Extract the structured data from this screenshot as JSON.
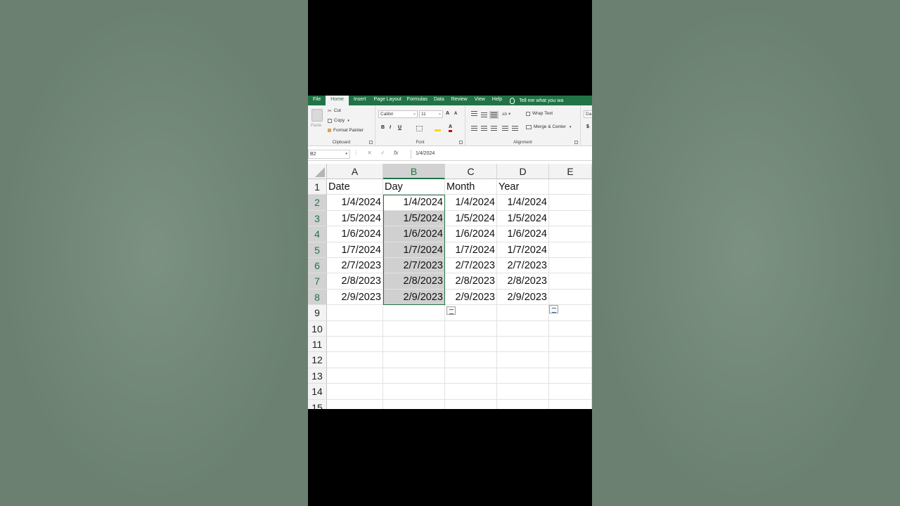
{
  "ribbon": {
    "tabs": [
      "File",
      "Home",
      "Insert",
      "Page Layout",
      "Formulas",
      "Data",
      "Review",
      "View",
      "Help"
    ],
    "active_tab": "Home",
    "tell_me": "Tell me what you wa",
    "clipboard": {
      "paste": "Paste",
      "cut": "Cut",
      "copy": "Copy",
      "format_painter": "Format Painter",
      "label": "Clipboard"
    },
    "font": {
      "name": "Calibri",
      "size": "11",
      "bold": "B",
      "italic": "I",
      "underline": "U",
      "grow": "A",
      "shrink": "A",
      "color_glyph": "A",
      "label": "Font"
    },
    "alignment": {
      "wrap_text": "Wrap Text",
      "merge_center": "Merge & Center",
      "label": "Alignment"
    },
    "number": {
      "format_fragment": "Da",
      "currency": "$"
    }
  },
  "formula_bar": {
    "name_box": "B2",
    "fx": "fx",
    "value": "1/4/2024"
  },
  "columns": [
    "A",
    "B",
    "C",
    "D",
    "E"
  ],
  "rows": [
    "1",
    "2",
    "3",
    "4",
    "5",
    "6",
    "7",
    "8",
    "9",
    "10",
    "11",
    "12",
    "13",
    "14",
    "15"
  ],
  "cells": [
    [
      "Date",
      "Day",
      "Month",
      "Year",
      ""
    ],
    [
      "1/4/2024",
      "1/4/2024",
      "1/4/2024",
      "1/4/2024",
      ""
    ],
    [
      "1/5/2024",
      "1/5/2024",
      "1/5/2024",
      "1/5/2024",
      ""
    ],
    [
      "1/6/2024",
      "1/6/2024",
      "1/6/2024",
      "1/6/2024",
      ""
    ],
    [
      "1/7/2024",
      "1/7/2024",
      "1/7/2024",
      "1/7/2024",
      ""
    ],
    [
      "2/7/2023",
      "2/7/2023",
      "2/7/2023",
      "2/7/2023",
      ""
    ],
    [
      "2/8/2023",
      "2/8/2023",
      "2/8/2023",
      "2/8/2023",
      ""
    ],
    [
      "2/9/2023",
      "2/9/2023",
      "2/9/2023",
      "2/9/2023",
      ""
    ]
  ],
  "colors": {
    "excel_green": "#217346",
    "selection_fill": "#d0d0d0"
  }
}
